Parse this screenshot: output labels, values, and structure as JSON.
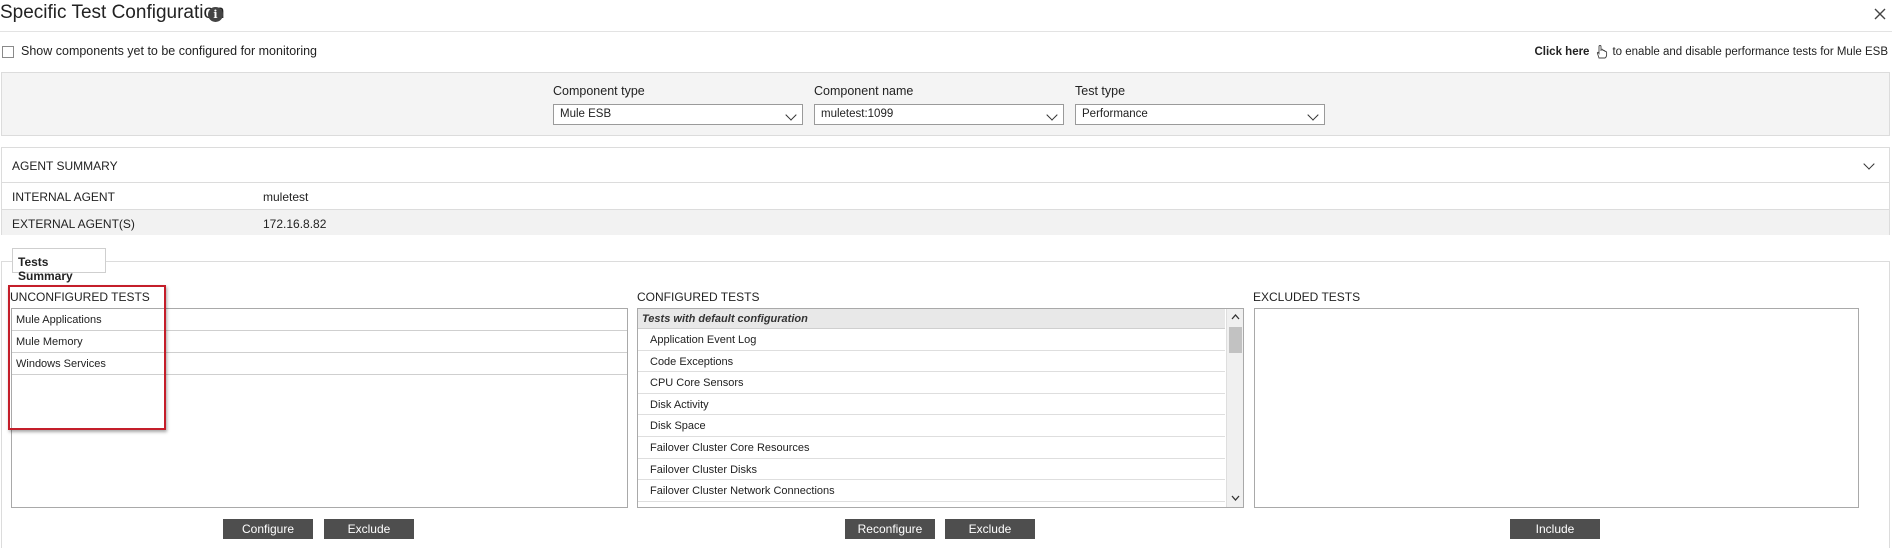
{
  "dialog": {
    "title": "Specific Test Configuration",
    "info_icon": "info-icon",
    "close_icon": "close-icon"
  },
  "options": {
    "show_components_label": "Show components yet to be configured for monitoring",
    "show_components_checked": false,
    "click_here_bold": "Click here",
    "click_here_rest": "to enable and disable performance tests for Mule ESB",
    "hand_icon": "hand-pointer-icon"
  },
  "filters": {
    "component_type_label": "Component type",
    "component_type_value": "Mule ESB",
    "component_name_label": "Component name",
    "component_name_value": "muletest:1099",
    "test_type_label": "Test type",
    "test_type_value": "Performance"
  },
  "agent_summary": {
    "heading": "AGENT SUMMARY",
    "rows": [
      {
        "key": "INTERNAL AGENT",
        "value": "muletest"
      },
      {
        "key": "EXTERNAL AGENT(S)",
        "value": "172.16.8.82"
      }
    ]
  },
  "tests": {
    "tab_label": "Tests Summary",
    "unconfigured": {
      "title": "UNCONFIGURED TESTS",
      "items": [
        "Mule Applications",
        "Mule Memory",
        "Windows Services"
      ],
      "configure_label": "Configure",
      "exclude_label": "Exclude"
    },
    "configured": {
      "title": "CONFIGURED TESTS",
      "group_header": "Tests with default configuration",
      "items": [
        "Application Event Log",
        "Code Exceptions",
        "CPU Core Sensors",
        "Disk Activity",
        "Disk Space",
        "Failover Cluster Core Resources",
        "Failover Cluster Disks",
        "Failover Cluster Network Connections"
      ],
      "reconfigure_label": "Reconfigure",
      "exclude_label": "Exclude"
    },
    "excluded": {
      "title": "EXCLUDED TESTS",
      "items": [],
      "include_label": "Include"
    }
  },
  "colors": {
    "button_bg": "#4e4e4e",
    "highlight_border": "#c41e2a",
    "panel_bg": "#f4f4f4"
  }
}
